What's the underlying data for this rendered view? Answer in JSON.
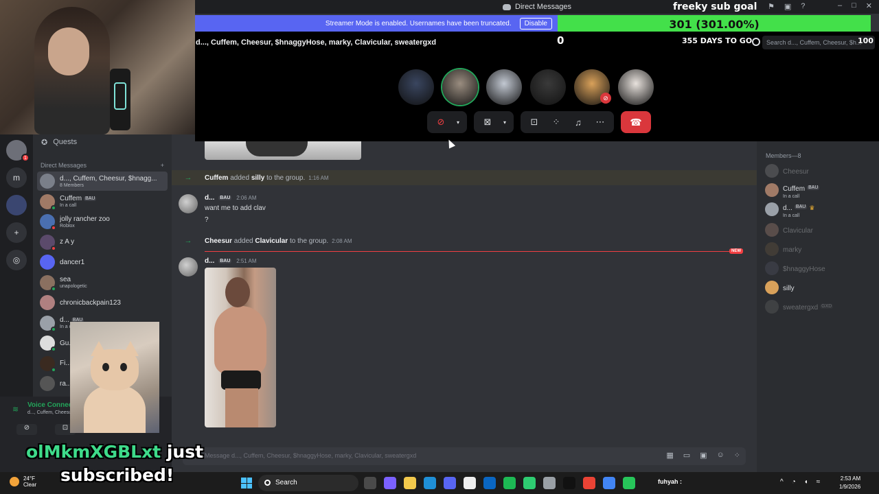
{
  "window": {
    "title": "Direct Messages"
  },
  "streamer_mode": {
    "message": "Streamer Mode is enabled. Usernames have been truncated.",
    "button": "Disable"
  },
  "sub_goal": {
    "title": "freeky sub goal",
    "progress_text": "301 (301.00%)",
    "progress_fraction": 1.0,
    "start": "0",
    "days_left": "355 DAYS TO GO",
    "target": "100",
    "bar_color": "#43e04a"
  },
  "call": {
    "group_name": "d..., Cuffem, Cheesur, $hnaggyHose, marky, Clavicular, sweatergxd",
    "search_placeholder": "Search d..., Cuffem, Cheesur, $h...",
    "participants": [
      {
        "name": "p1",
        "color": "#3a4660",
        "speaking": false,
        "muted": false
      },
      {
        "name": "p2",
        "color": "#9a8d80",
        "speaking": true,
        "muted": false
      },
      {
        "name": "p3",
        "color": "#c2c8d2",
        "speaking": false,
        "muted": false
      },
      {
        "name": "p4",
        "color": "#3a3a3a",
        "speaking": false,
        "muted": false
      },
      {
        "name": "p5",
        "color": "#d9a15a",
        "speaking": false,
        "muted": true
      },
      {
        "name": "p6",
        "color": "#e8e2dd",
        "speaking": false,
        "muted": false
      }
    ]
  },
  "rail": {
    "items": [
      {
        "label": "",
        "badge": "1"
      },
      {
        "label": "m"
      },
      {
        "label": ""
      },
      {
        "label": "+"
      },
      {
        "label": "◎"
      }
    ]
  },
  "sidebar": {
    "quests": "Quests",
    "dm_header": "Direct Messages",
    "add": "+",
    "items": [
      {
        "name": "d..., Cuffem, Cheesur, $hnagg...",
        "sub": "8 Members",
        "color": "#7a7f89",
        "status": "",
        "active": true
      },
      {
        "name": "Cuffem",
        "tag": "BAU",
        "sub": "In a call",
        "color": "#a07a66",
        "status": "on"
      },
      {
        "name": "jolly rancher zoo",
        "sub": "Roblox",
        "color": "#4a6fb0",
        "status": "dnd"
      },
      {
        "name": "z A y",
        "sub": "",
        "color": "#5b4a6b",
        "status": "dnd"
      },
      {
        "name": "dancer1",
        "sub": "",
        "color": "#5865f2",
        "status": ""
      },
      {
        "name": "sea",
        "sub": "unapologetic",
        "color": "#8a7060",
        "status": "on"
      },
      {
        "name": "chronicbackpain123",
        "sub": "",
        "color": "#b08080",
        "status": ""
      },
      {
        "name": "d...",
        "tag": "BAU",
        "sub": "In a call",
        "color": "#9aa0a8",
        "status": "on"
      },
      {
        "name": "Gu...",
        "sub": "",
        "color": "#dddddd",
        "status": "on"
      },
      {
        "name": "Fi...",
        "sub": "",
        "color": "#3a2a20",
        "status": "on"
      },
      {
        "name": "ra...",
        "sub": "",
        "color": "#555555",
        "status": ""
      }
    ]
  },
  "voice": {
    "title": "Voice Connected",
    "sub": "d..., Cuffem, Cheesur, $hnaggyHose",
    "cam_icon": "⊘",
    "screen_icon": "⊡"
  },
  "sub_alert": {
    "username": "olMkmXGBLxt",
    "line1": " just",
    "line2": "subscribed!"
  },
  "chat": {
    "messages": [
      {
        "type": "system",
        "actor": "Cuffem",
        "verb": "added",
        "target": "silly",
        "suffix": "to the group.",
        "time": "1:16 AM"
      },
      {
        "type": "message",
        "author": "d...",
        "tag": "BAU",
        "time": "2:06 AM",
        "lines": [
          "want me to add clav",
          "?"
        ]
      },
      {
        "type": "system",
        "actor": "Cheesur",
        "verb": "added",
        "target": "Clavicular",
        "suffix": "to the group.",
        "time": "2:08 AM"
      },
      {
        "type": "message",
        "author": "d...",
        "tag": "BAU",
        "time": "2:51 AM",
        "attachment": "photo"
      }
    ],
    "new_tag": "NEW",
    "composer_placeholder": "Message d..., Cuffem, Cheesur, $hnaggyHose, marky, Clavicular, sweatergxd"
  },
  "members": {
    "header": "Members—8",
    "items": [
      {
        "name": "Cheesur",
        "online": false,
        "color": "#888"
      },
      {
        "name": "Cuffem",
        "tag": "BAU",
        "sub": "In a call",
        "online": true,
        "color": "#a07a66"
      },
      {
        "name": "d...",
        "tag": "BAU",
        "crown": "♛",
        "sub": "In a call",
        "online": true,
        "color": "#9aa0a8"
      },
      {
        "name": "Clavicular",
        "online": false,
        "color": "#b08a7a"
      },
      {
        "name": "marky",
        "online": false,
        "color": "#6a5a40"
      },
      {
        "name": "$hnaggyHose",
        "online": false,
        "color": "#556"
      },
      {
        "name": "silly",
        "online": true,
        "color": "#d9a15a"
      },
      {
        "name": "sweatergxd",
        "tag": "GXD",
        "online": false,
        "color": "#666"
      }
    ]
  },
  "taskbar": {
    "weather_temp": "24°F",
    "weather_cond": "Clear",
    "search": "Search",
    "apps": [
      "#4a4a4a",
      "#7b61ff",
      "#f2c94c",
      "#1f8fd6",
      "#5865f2",
      "#eeeeee",
      "#0a66c2",
      "#1db954",
      "#2ecc71",
      "#9aa0a6",
      "#111111",
      "#ea4335",
      "#4285f4",
      "#27c55a"
    ],
    "user_label": "fuhyah :",
    "time": "2:53 AM",
    "date": "1/9/2026"
  },
  "colors": {
    "accent": "#5865f2",
    "online": "#23a55a",
    "danger": "#da373c"
  }
}
